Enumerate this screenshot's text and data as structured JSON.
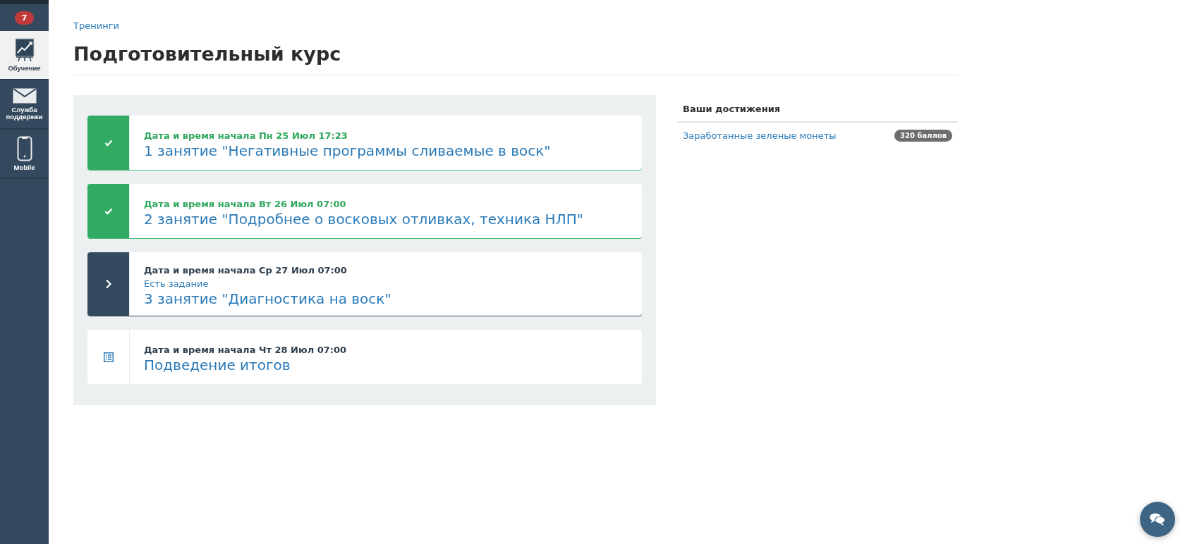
{
  "sidebar": {
    "badge": "7",
    "items": [
      {
        "label": "Обучение",
        "kind": "training",
        "selected": true
      },
      {
        "label": "Служба поддержки",
        "kind": "mail",
        "selected": false
      },
      {
        "label": "Mobile",
        "kind": "phone",
        "selected": false
      }
    ]
  },
  "breadcrumb": "Тренинги",
  "title": "Подготовительный курс",
  "lessons": [
    {
      "kind": "completed",
      "date": "Дата и время начала Пн 25 Июл 17:23",
      "title": "1 занятие \"Негативные программы сливаемые в воск\""
    },
    {
      "kind": "completed",
      "date": "Дата и время начала Вт 26 Июл 07:00",
      "title": "2 занятие \"Подробнее о восковых отливках, техника НЛП\""
    },
    {
      "kind": "current",
      "date": "Дата и время начала Ср 27 Июл 07:00",
      "note": "Есть задание",
      "title": "3 занятие \"Диагностика на воск\""
    },
    {
      "kind": "summary",
      "date": "Дата и время начала Чт 28 Июл 07:00",
      "title": "Подведение итогов"
    }
  ],
  "achievements": {
    "heading": "Ваши достижения",
    "items": [
      {
        "label": "Заработанные зеленые монеты",
        "value": "320 баллов"
      }
    ]
  }
}
